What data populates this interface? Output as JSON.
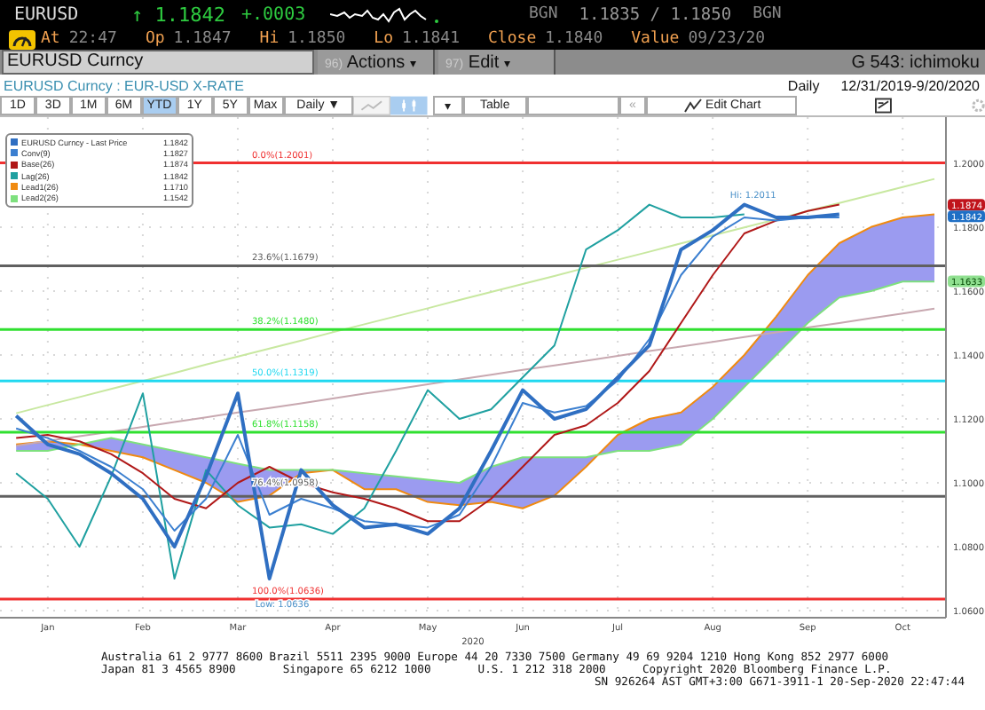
{
  "quote": {
    "ticker": "EURUSD",
    "arrow": "↑",
    "price": "1.1842",
    "change": "+.0003",
    "bid_source": "BGN",
    "bid_ask": "1.1835 / 1.1850",
    "ask_source": "BGN"
  },
  "stats": [
    {
      "label": "At",
      "value": "22:47"
    },
    {
      "label": "Op",
      "value": "1.1847"
    },
    {
      "label": "Hi",
      "value": "1.1850"
    },
    {
      "label": "Lo",
      "value": "1.1841"
    },
    {
      "label": "Close",
      "value": "1.1840"
    },
    {
      "label": "Value",
      "value": "09/23/20"
    }
  ],
  "command_bar": {
    "security": "EURUSD Curncy",
    "menus": [
      {
        "number": "96)",
        "label": "Actions",
        "caret": "▾"
      },
      {
        "number": "97)",
        "label": "Edit",
        "caret": "▾"
      }
    ],
    "function": "G 543: ichimoku"
  },
  "subtitle": {
    "security": "EURUSD Curncy : EUR-USD X-RATE",
    "frequency": "Daily",
    "range": "12/31/2019-9/20/2020"
  },
  "toolbar": {
    "periods": [
      {
        "label": "1D",
        "selected": false
      },
      {
        "label": "3D",
        "selected": false
      },
      {
        "label": "1M",
        "selected": false
      },
      {
        "label": "6M",
        "selected": false
      },
      {
        "label": "YTD",
        "selected": true
      },
      {
        "label": "1Y",
        "selected": false
      },
      {
        "label": "5Y",
        "selected": false
      },
      {
        "label": "Max",
        "selected": false
      }
    ],
    "frequency": "Daily ▼",
    "dropdown": "▾",
    "table": "Table",
    "back": "«",
    "edit_chart": "Edit Chart"
  },
  "chart": {
    "legend_values": [
      "1.1842",
      "1.1827",
      "1.1874",
      "1.1842",
      "1.1710",
      "1.1542"
    ],
    "chart_data": {
      "type": "line",
      "xlabel": "2020",
      "categories": [
        null,
        "Jan",
        null,
        null,
        "Feb",
        null,
        null,
        "Mar",
        null,
        null,
        "Apr",
        null,
        null,
        "May",
        null,
        null,
        "Jun",
        null,
        null,
        "Jul",
        null,
        null,
        "Aug",
        null,
        null,
        "Sep",
        null,
        null,
        "Oct",
        null
      ],
      "series": [
        {
          "name": "EURUSD Curncy - Last Price",
          "color": "#2f6fc2",
          "values": [
            1.121,
            1.112,
            1.109,
            1.103,
            1.095,
            1.08,
            1.102,
            1.128,
            1.07,
            1.104,
            1.093,
            1.086,
            1.087,
            1.084,
            1.092,
            1.11,
            1.129,
            1.12,
            1.123,
            1.133,
            1.143,
            1.173,
            1.179,
            1.187,
            1.183,
            1.183,
            1.184,
            null,
            null,
            null
          ]
        },
        {
          "name": "Conv(9)",
          "color": "#3b7fd0",
          "values": [
            1.117,
            1.114,
            1.11,
            1.105,
            1.098,
            1.085,
            1.095,
            1.115,
            1.09,
            1.095,
            1.092,
            1.088,
            1.087,
            1.086,
            1.09,
            1.105,
            1.125,
            1.122,
            1.124,
            1.132,
            1.145,
            1.165,
            1.177,
            1.183,
            1.182,
            1.183,
            1.183,
            null,
            null,
            null
          ]
        },
        {
          "name": "Base(26)",
          "color": "#b01818",
          "values": [
            1.114,
            1.115,
            1.113,
            1.109,
            1.103,
            1.095,
            1.092,
            1.1,
            1.105,
            1.1,
            1.097,
            1.095,
            1.092,
            1.088,
            1.088,
            1.095,
            1.105,
            1.115,
            1.118,
            1.125,
            1.135,
            1.15,
            1.165,
            1.178,
            1.182,
            1.185,
            1.187,
            null,
            null,
            null
          ]
        },
        {
          "name": "Lag(26)",
          "color": "#1fa0a0",
          "values": [
            1.103,
            1.095,
            1.08,
            1.102,
            1.128,
            1.07,
            1.104,
            1.093,
            1.086,
            1.087,
            1.084,
            1.092,
            1.11,
            1.129,
            1.12,
            1.123,
            1.133,
            1.143,
            1.173,
            1.179,
            1.187,
            1.183,
            1.183,
            1.184,
            null,
            null,
            null,
            null,
            null,
            null
          ]
        },
        {
          "name": "Lead1(26)",
          "color": "#f08a10",
          "values": [
            1.112,
            1.113,
            1.112,
            1.11,
            1.108,
            1.104,
            1.1,
            1.094,
            1.096,
            1.103,
            1.104,
            1.098,
            1.098,
            1.094,
            1.093,
            1.094,
            1.092,
            1.096,
            1.105,
            1.115,
            1.12,
            1.122,
            1.13,
            1.14,
            1.152,
            1.165,
            1.175,
            1.18,
            1.183,
            1.184
          ]
        },
        {
          "name": "Lead2(26)",
          "color": "#7ee07e",
          "values": [
            1.11,
            1.11,
            1.112,
            1.114,
            1.112,
            1.11,
            1.108,
            1.106,
            1.104,
            1.104,
            1.104,
            1.103,
            1.102,
            1.101,
            1.1,
            1.105,
            1.108,
            1.108,
            1.108,
            1.11,
            1.11,
            1.112,
            1.12,
            1.13,
            1.14,
            1.15,
            1.158,
            1.16,
            1.163,
            1.163
          ]
        },
        {
          "color": "#c8e8a0",
          "values": [
            1.1218,
            1.1243,
            1.1268,
            1.1294,
            1.1319,
            1.1344,
            1.137,
            1.1395,
            1.142,
            1.1445,
            1.1471,
            1.1496,
            1.1521,
            1.1546,
            1.1572,
            1.1597,
            1.1622,
            1.1647,
            1.1673,
            1.1698,
            1.1723,
            1.1749,
            1.1774,
            1.1799,
            1.1824,
            1.185,
            1.1875,
            1.19,
            1.1925,
            1.1951
          ]
        },
        {
          "color": "#c8a8b0",
          "values": [
            1.1116,
            1.1131,
            1.1146,
            1.116,
            1.1175,
            1.119,
            1.1205,
            1.122,
            1.1234,
            1.1249,
            1.1264,
            1.1279,
            1.1293,
            1.1308,
            1.1323,
            1.1338,
            1.1353,
            1.1367,
            1.1382,
            1.1397,
            1.1412,
            1.1426,
            1.1441,
            1.1456,
            1.1471,
            1.1486,
            1.15,
            1.1515,
            1.153,
            1.1545
          ]
        }
      ],
      "ylim": [
        1.0578,
        1.2144
      ],
      "grid": true,
      "yticks": [
        {
          "value": 1.06,
          "label": "1.0600"
        },
        {
          "value": 1.08,
          "label": "1.0800"
        },
        {
          "value": 1.1,
          "label": "1.1000"
        },
        {
          "value": 1.12,
          "label": "1.1200"
        },
        {
          "value": 1.14,
          "label": "1.1400"
        },
        {
          "value": 1.16,
          "label": "1.1600"
        },
        {
          "value": 1.18,
          "label": "1.1800"
        },
        {
          "value": 1.2,
          "label": "1.2000"
        }
      ],
      "ref_lines": [
        {
          "axis": "y",
          "value": 1.2001,
          "label": "0.0%(1.2001)",
          "color": "#f03030"
        },
        {
          "axis": "y",
          "value": 1.1679,
          "label": "23.6%(1.1679)",
          "color": "#606060"
        },
        {
          "axis": "y",
          "value": 1.148,
          "label": "38.2%(1.1480)",
          "color": "#30e030"
        },
        {
          "axis": "y",
          "value": 1.1319,
          "label": "50.0%(1.1319)",
          "color": "#20d8f0"
        },
        {
          "axis": "y",
          "value": 1.1158,
          "label": "61.8%(1.1158)",
          "color": "#30e030"
        },
        {
          "axis": "y",
          "value": 1.0958,
          "label": "76.4%(1.0958)",
          "color": "#606060"
        },
        {
          "axis": "y",
          "value": 1.0636,
          "label": "100.0%(1.0636)",
          "color": "#f03030"
        }
      ],
      "annotations": [
        "Hi: 1.2011",
        "Low: 1.0636"
      ]
    },
    "price_tags": [
      {
        "label": "1.1874",
        "color": "#c0141c"
      },
      {
        "label": "1.1842",
        "color": "#1f6fc5"
      },
      {
        "label": "1.1633",
        "color": "#90e090"
      }
    ]
  },
  "footer": {
    "lines": [
      "Australia 61 2 9777 8600 Brazil 5511 2395 9000 Europe 44 20 7330 7500 Germany 49 69 9204 1210 Hong Kong 852 2977 6000",
      "Japan 81 3 4565 8900       Singapore 65 6212 1000       U.S. 1 212 318 2000"
    ],
    "copyright": "Copyright 2020 Bloomberg Finance L.P.",
    "session": "SN 926264 AST  GMT+3:00 G671-3911-1 20-Sep-2020 22:47:44"
  }
}
